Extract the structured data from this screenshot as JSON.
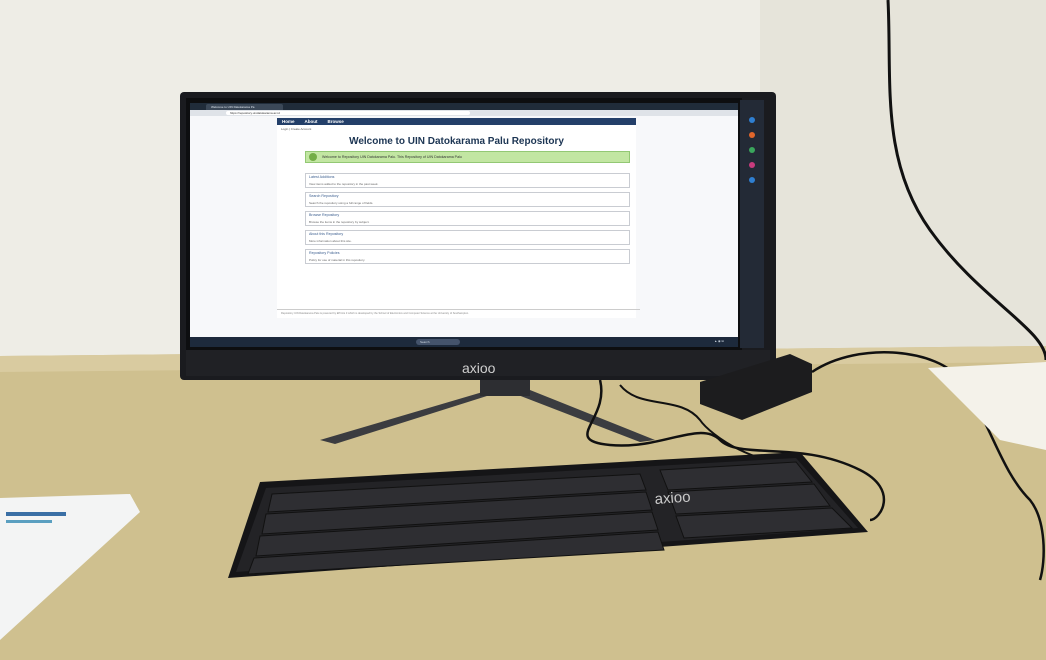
{
  "browser": {
    "tab_title": "Welcome to UIN Datokarama Pa",
    "url": "https://repository.uindatokarama.ac.id"
  },
  "site": {
    "menu": [
      "Home",
      "About",
      "Browse"
    ],
    "breadcrumb": "Login | Create Account",
    "title": "Welcome to UIN Datokarama Palu Repository",
    "welcome_text": "Welcome to Repository UIN Datokarama Palu. This Repository of UIN Datokarama Palu",
    "sections": [
      {
        "heading": "Latest Additions",
        "desc": "View items added to the repository in the past week."
      },
      {
        "heading": "Search Repository",
        "desc": "Search the repository using a full range of fields."
      },
      {
        "heading": "Browse Repository",
        "desc": "Browse the items in the repository by subject."
      },
      {
        "heading": "About this Repository",
        "desc": "More information about this site."
      },
      {
        "heading": "Repository Policies",
        "desc": "Policy for use of material in this repository."
      }
    ],
    "footer": "Repository UIN Datokarama Palu is powered by EPrints 3 which is developed by the School of Electronics and Computer Science at the University of Southampton."
  },
  "taskbar": {
    "search_label": "Search"
  },
  "brand": "axioo",
  "colors": {
    "monitor_bezel": "#1a1b1f",
    "desk": "#cfbf8e",
    "wall": "#eeede6",
    "site_menu": "#233f69",
    "welcome_bar": "#c2e6a2"
  }
}
